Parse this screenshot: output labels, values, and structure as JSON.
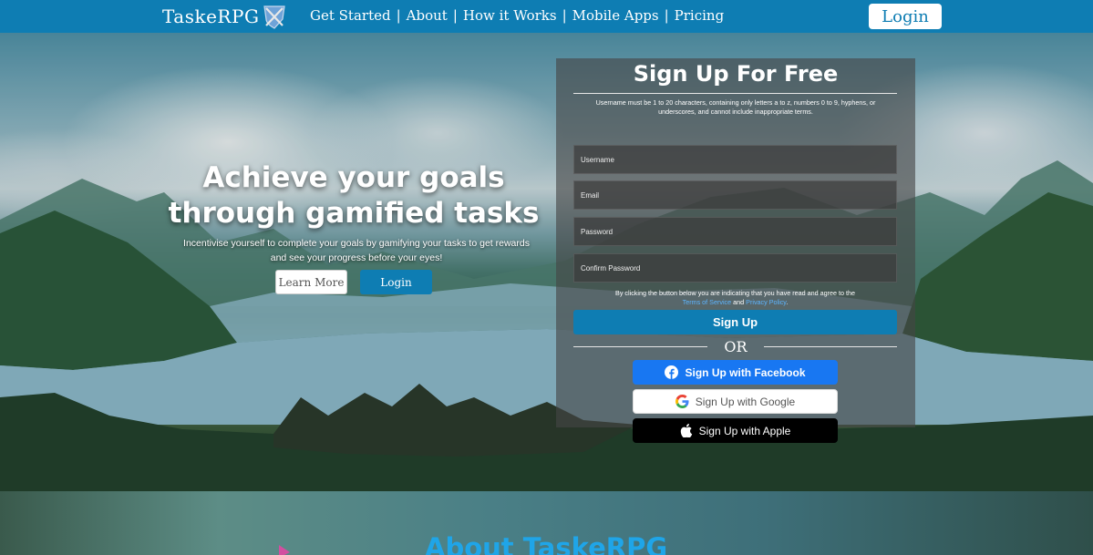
{
  "header": {
    "brand": "TaskeRPG",
    "nav": [
      "Get Started",
      "About",
      "How it Works",
      "Mobile Apps",
      "Pricing"
    ],
    "login_label": "Login"
  },
  "hero": {
    "headline": "Achieve your goals through gamified tasks",
    "subline": "Incentivise yourself to complete your goals by gamifying your tasks to get rewards and see your progress before your eyes!",
    "learn_more_label": "Learn More",
    "login_label": "Login"
  },
  "signup": {
    "title": "Sign Up For Free",
    "hint": "Username must be 1 to 20 characters, containing only letters a to z, numbers 0 to 9, hyphens, or underscores, and cannot include inappropriate terms.",
    "fields": {
      "username_placeholder": "Username",
      "email_placeholder": "Email",
      "password_placeholder": "Password",
      "confirm_placeholder": "Confirm Password"
    },
    "terms_prefix": "By clicking the button below you are indicating that you have read and agree to the",
    "terms_link": "Terms of Service",
    "terms_and": "and",
    "privacy_link": "Privacy Policy",
    "terms_suffix": ".",
    "submit_label": "Sign Up",
    "or_label": "OR",
    "facebook_label": "Sign Up with Facebook",
    "google_label": "Sign Up with Google",
    "apple_label": "Sign Up with Apple"
  },
  "about": {
    "title": "About TaskeRPG"
  },
  "colors": {
    "brand_blue": "#0e7db3",
    "facebook_blue": "#1877f2",
    "about_title": "#1fa5e8"
  },
  "icons": [
    "brand-shield-icon",
    "facebook-icon",
    "google-icon",
    "apple-icon"
  ]
}
